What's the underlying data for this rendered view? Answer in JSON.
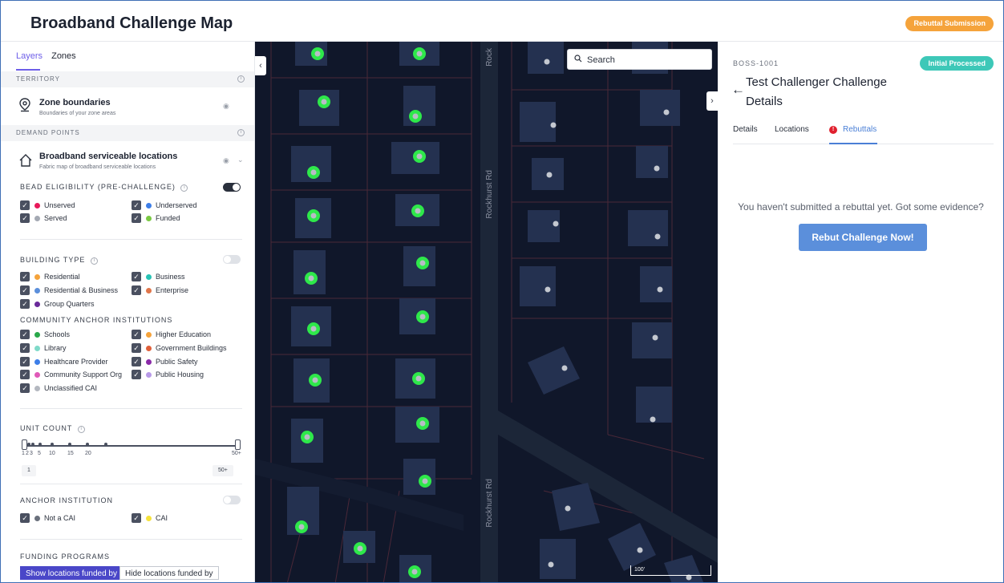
{
  "header": {
    "title": "Broadband Challenge Map",
    "action_label": "Rebuttal Submission"
  },
  "left_panel": {
    "tabs": [
      "Layers",
      "Zones"
    ],
    "territory_header": "TERRITORY",
    "zone_boundaries": {
      "title": "Zone boundaries",
      "subtitle": "Boundaries of your zone areas"
    },
    "demand_header": "DEMAND POINTS",
    "bsl": {
      "title": "Broadband serviceable locations",
      "subtitle": "Fabric map of broadband serviceable locations"
    },
    "bead": {
      "heading": "BEAD ELIGIBILITY (PRE-CHALLENGE)",
      "toggle_on": true,
      "items": [
        {
          "label": "Unserved",
          "color": "#e8195a"
        },
        {
          "label": "Underserved",
          "color": "#3d7ee8"
        },
        {
          "label": "Served",
          "color": "#a4a9b3"
        },
        {
          "label": "Funded",
          "color": "#7ac943"
        }
      ]
    },
    "building": {
      "heading": "BUILDING TYPE",
      "toggle_on": false,
      "items": [
        {
          "label": "Residential",
          "color": "#f5a33b"
        },
        {
          "label": "Business",
          "color": "#27c3b5"
        },
        {
          "label": "Residential & Business",
          "color": "#5b8fdb"
        },
        {
          "label": "Enterprise",
          "color": "#e0754a"
        },
        {
          "label": "Group Quarters",
          "color": "#6a2a9a"
        }
      ]
    },
    "cai": {
      "heading": "COMMUNITY ANCHOR INSTITUTIONS",
      "items": [
        {
          "label": "Schools",
          "color": "#2aa84a"
        },
        {
          "label": "Higher Education",
          "color": "#f5a33b"
        },
        {
          "label": "Library",
          "color": "#7fdac9"
        },
        {
          "label": "Government Buildings",
          "color": "#e0603a"
        },
        {
          "label": "Healthcare Provider",
          "color": "#3d7ee8"
        },
        {
          "label": "Public Safety",
          "color": "#8a2aa8"
        },
        {
          "label": "Community Support Org",
          "color": "#e05ab8"
        },
        {
          "label": "Public Housing",
          "color": "#b89ae8"
        },
        {
          "label": "Unclassified CAI",
          "color": "#b4b8c0"
        }
      ]
    },
    "unit_count": {
      "heading": "UNIT COUNT",
      "ticks": [
        "1",
        "2",
        "3",
        "5",
        "10",
        "15",
        "20",
        "50+"
      ],
      "min_value": "1",
      "max_value": "50+"
    },
    "anchor": {
      "heading": "ANCHOR INSTITUTION",
      "toggle_on": false,
      "items": [
        {
          "label": "Not a CAI",
          "color": "#6a707c"
        },
        {
          "label": "CAI",
          "color": "#f5e23b"
        }
      ]
    },
    "funding": {
      "heading": "FUNDING PROGRAMS",
      "show_label": "Show locations funded by",
      "hide_label": "Hide locations funded by"
    }
  },
  "map": {
    "search_placeholder": "Search",
    "street_labels": [
      "Rock",
      "Rockhurst Rd",
      "Rockhurst Rd"
    ],
    "scale_label": "100'",
    "colors": {
      "background": "#10172a",
      "building": "#243150",
      "parcel_line": "#5a3040",
      "road": "#1c2638",
      "highlight": "#2ee84a"
    }
  },
  "right_panel": {
    "id": "BOSS-1001",
    "status": "Initial Processed",
    "title": "Test Challenger Challenge Details",
    "tabs": [
      "Details",
      "Locations",
      "Rebuttals"
    ],
    "alert_glyph": "!",
    "empty_message": "You haven't submitted a rebuttal yet. Got some evidence?",
    "cta_label": "Rebut Challenge Now!"
  }
}
